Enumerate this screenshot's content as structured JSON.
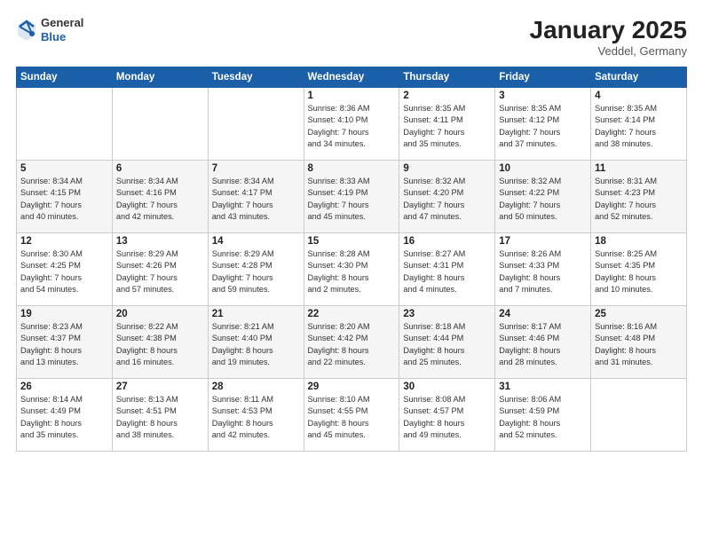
{
  "header": {
    "logo_general": "General",
    "logo_blue": "Blue",
    "month_title": "January 2025",
    "location": "Veddel, Germany"
  },
  "weekdays": [
    "Sunday",
    "Monday",
    "Tuesday",
    "Wednesday",
    "Thursday",
    "Friday",
    "Saturday"
  ],
  "weeks": [
    [
      {
        "day": "",
        "info": ""
      },
      {
        "day": "",
        "info": ""
      },
      {
        "day": "",
        "info": ""
      },
      {
        "day": "1",
        "info": "Sunrise: 8:36 AM\nSunset: 4:10 PM\nDaylight: 7 hours\nand 34 minutes."
      },
      {
        "day": "2",
        "info": "Sunrise: 8:35 AM\nSunset: 4:11 PM\nDaylight: 7 hours\nand 35 minutes."
      },
      {
        "day": "3",
        "info": "Sunrise: 8:35 AM\nSunset: 4:12 PM\nDaylight: 7 hours\nand 37 minutes."
      },
      {
        "day": "4",
        "info": "Sunrise: 8:35 AM\nSunset: 4:14 PM\nDaylight: 7 hours\nand 38 minutes."
      }
    ],
    [
      {
        "day": "5",
        "info": "Sunrise: 8:34 AM\nSunset: 4:15 PM\nDaylight: 7 hours\nand 40 minutes."
      },
      {
        "day": "6",
        "info": "Sunrise: 8:34 AM\nSunset: 4:16 PM\nDaylight: 7 hours\nand 42 minutes."
      },
      {
        "day": "7",
        "info": "Sunrise: 8:34 AM\nSunset: 4:17 PM\nDaylight: 7 hours\nand 43 minutes."
      },
      {
        "day": "8",
        "info": "Sunrise: 8:33 AM\nSunset: 4:19 PM\nDaylight: 7 hours\nand 45 minutes."
      },
      {
        "day": "9",
        "info": "Sunrise: 8:32 AM\nSunset: 4:20 PM\nDaylight: 7 hours\nand 47 minutes."
      },
      {
        "day": "10",
        "info": "Sunrise: 8:32 AM\nSunset: 4:22 PM\nDaylight: 7 hours\nand 50 minutes."
      },
      {
        "day": "11",
        "info": "Sunrise: 8:31 AM\nSunset: 4:23 PM\nDaylight: 7 hours\nand 52 minutes."
      }
    ],
    [
      {
        "day": "12",
        "info": "Sunrise: 8:30 AM\nSunset: 4:25 PM\nDaylight: 7 hours\nand 54 minutes."
      },
      {
        "day": "13",
        "info": "Sunrise: 8:29 AM\nSunset: 4:26 PM\nDaylight: 7 hours\nand 57 minutes."
      },
      {
        "day": "14",
        "info": "Sunrise: 8:29 AM\nSunset: 4:28 PM\nDaylight: 7 hours\nand 59 minutes."
      },
      {
        "day": "15",
        "info": "Sunrise: 8:28 AM\nSunset: 4:30 PM\nDaylight: 8 hours\nand 2 minutes."
      },
      {
        "day": "16",
        "info": "Sunrise: 8:27 AM\nSunset: 4:31 PM\nDaylight: 8 hours\nand 4 minutes."
      },
      {
        "day": "17",
        "info": "Sunrise: 8:26 AM\nSunset: 4:33 PM\nDaylight: 8 hours\nand 7 minutes."
      },
      {
        "day": "18",
        "info": "Sunrise: 8:25 AM\nSunset: 4:35 PM\nDaylight: 8 hours\nand 10 minutes."
      }
    ],
    [
      {
        "day": "19",
        "info": "Sunrise: 8:23 AM\nSunset: 4:37 PM\nDaylight: 8 hours\nand 13 minutes."
      },
      {
        "day": "20",
        "info": "Sunrise: 8:22 AM\nSunset: 4:38 PM\nDaylight: 8 hours\nand 16 minutes."
      },
      {
        "day": "21",
        "info": "Sunrise: 8:21 AM\nSunset: 4:40 PM\nDaylight: 8 hours\nand 19 minutes."
      },
      {
        "day": "22",
        "info": "Sunrise: 8:20 AM\nSunset: 4:42 PM\nDaylight: 8 hours\nand 22 minutes."
      },
      {
        "day": "23",
        "info": "Sunrise: 8:18 AM\nSunset: 4:44 PM\nDaylight: 8 hours\nand 25 minutes."
      },
      {
        "day": "24",
        "info": "Sunrise: 8:17 AM\nSunset: 4:46 PM\nDaylight: 8 hours\nand 28 minutes."
      },
      {
        "day": "25",
        "info": "Sunrise: 8:16 AM\nSunset: 4:48 PM\nDaylight: 8 hours\nand 31 minutes."
      }
    ],
    [
      {
        "day": "26",
        "info": "Sunrise: 8:14 AM\nSunset: 4:49 PM\nDaylight: 8 hours\nand 35 minutes."
      },
      {
        "day": "27",
        "info": "Sunrise: 8:13 AM\nSunset: 4:51 PM\nDaylight: 8 hours\nand 38 minutes."
      },
      {
        "day": "28",
        "info": "Sunrise: 8:11 AM\nSunset: 4:53 PM\nDaylight: 8 hours\nand 42 minutes."
      },
      {
        "day": "29",
        "info": "Sunrise: 8:10 AM\nSunset: 4:55 PM\nDaylight: 8 hours\nand 45 minutes."
      },
      {
        "day": "30",
        "info": "Sunrise: 8:08 AM\nSunset: 4:57 PM\nDaylight: 8 hours\nand 49 minutes."
      },
      {
        "day": "31",
        "info": "Sunrise: 8:06 AM\nSunset: 4:59 PM\nDaylight: 8 hours\nand 52 minutes."
      },
      {
        "day": "",
        "info": ""
      }
    ]
  ]
}
